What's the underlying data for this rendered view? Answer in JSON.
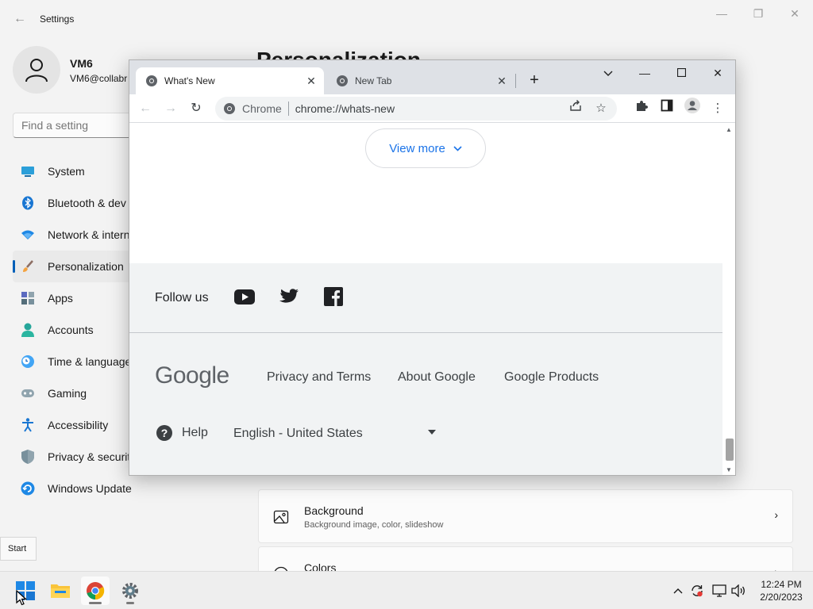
{
  "settings": {
    "title": "Settings",
    "user": {
      "name": "VM6",
      "email": "VM6@collabr"
    },
    "search_placeholder": "Find a setting",
    "nav": [
      {
        "label": "System",
        "icon": "monitor-icon"
      },
      {
        "label": "Bluetooth & dev",
        "icon": "bluetooth-icon"
      },
      {
        "label": "Network & intern",
        "icon": "wifi-icon"
      },
      {
        "label": "Personalization",
        "icon": "paintbrush-icon",
        "active": true
      },
      {
        "label": "Apps",
        "icon": "apps-icon"
      },
      {
        "label": "Accounts",
        "icon": "person-icon"
      },
      {
        "label": "Time & language",
        "icon": "clock-globe-icon"
      },
      {
        "label": "Gaming",
        "icon": "gamepad-icon"
      },
      {
        "label": "Accessibility",
        "icon": "accessibility-icon"
      },
      {
        "label": "Privacy & securit",
        "icon": "shield-icon"
      },
      {
        "label": "Windows Update",
        "icon": "update-icon"
      }
    ],
    "page_title": "Personalization",
    "cards": [
      {
        "title": "Background",
        "desc": "Background image, color, slideshow",
        "icon": "background-image-icon"
      },
      {
        "title": "Colors",
        "desc": "",
        "icon": "palette-icon"
      }
    ]
  },
  "chrome": {
    "tabs": [
      {
        "title": "What's New",
        "active": true
      },
      {
        "title": "New Tab",
        "active": false
      }
    ],
    "omnibox": {
      "label": "Chrome",
      "url": "chrome://whats-new"
    },
    "view_more": "View more",
    "footer": {
      "follow_us": "Follow us",
      "google_logo": "Google",
      "links": [
        "Privacy and Terms",
        "About Google",
        "Google Products"
      ],
      "help": "Help",
      "language": "English - United States"
    }
  },
  "tooltip": "Start",
  "taskbar": {
    "time": "12:24 PM",
    "date": "2/20/2023"
  },
  "colors": {
    "accent": "#005fb8",
    "chrome_link": "#1a73e8",
    "footer_bg": "#f1f3f4",
    "tabbar_bg": "#dee1e6"
  }
}
